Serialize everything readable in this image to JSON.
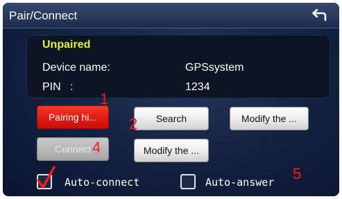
{
  "window": {
    "title": "Pair/Connect",
    "back_icon": "back-arrow-icon"
  },
  "status": {
    "pairing_state": "Unpaired",
    "device_name_label": "Device name:",
    "device_name_value": "GPSsystem",
    "pin_label": "PIN   :",
    "pin_value": "1234"
  },
  "buttons": {
    "pairing": "Pairing hi...",
    "search": "Search",
    "modify_top": "Modify the ...",
    "connect": "Connect",
    "modify_bottom": "Modify the ..."
  },
  "options": {
    "auto_connect_label": "Auto-connect",
    "auto_connect_checked": true,
    "auto_answer_label": "Auto-answer",
    "auto_answer_checked": false
  },
  "annotations": {
    "n1": "1",
    "n2": "2",
    "n4": "4",
    "n5": "5"
  },
  "colors": {
    "status_text": "#e8ef2b",
    "active_button": "#e0180f",
    "annotation": "#ff1a1a",
    "background": "#152444"
  }
}
